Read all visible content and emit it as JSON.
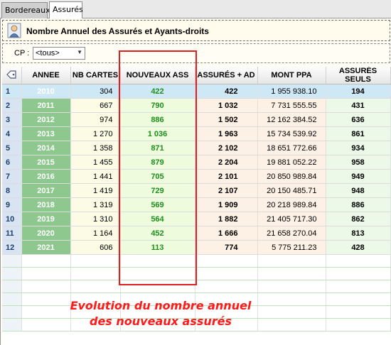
{
  "tabs": [
    {
      "label": "Bordereaux",
      "active": false
    },
    {
      "label": "Assurés",
      "active": true
    }
  ],
  "header": {
    "title": "Nombre Annuel des Assurés et Ayants-droits",
    "icon": "user-icon"
  },
  "filter": {
    "label": "CP :",
    "selected": "<tous>"
  },
  "table": {
    "columns": [
      "",
      "ANNEE",
      "NB CARTES",
      "NOUVEAUX ASS",
      "ASSURÉS + AD",
      "MONT PPA",
      "ASSURÉS SEULS"
    ],
    "rows": [
      [
        "1",
        "2010",
        "304",
        "422",
        "422",
        "1 955 938.10",
        "194"
      ],
      [
        "2",
        "2011",
        "667",
        "790",
        "1 032",
        "7 731 555.55",
        "431"
      ],
      [
        "3",
        "2012",
        "974",
        "886",
        "1 502",
        "12 162 384.52",
        "636"
      ],
      [
        "4",
        "2013",
        "1 270",
        "1 036",
        "1 963",
        "15 734 539.92",
        "861"
      ],
      [
        "5",
        "2014",
        "1 358",
        "871",
        "2 102",
        "18 651 772.66",
        "934"
      ],
      [
        "6",
        "2015",
        "1 455",
        "879",
        "2 204",
        "19 881 052.22",
        "958"
      ],
      [
        "7",
        "2016",
        "1 441",
        "705",
        "2 101",
        "20 850 989.84",
        "949"
      ],
      [
        "8",
        "2017",
        "1 419",
        "729",
        "2 107",
        "20 150 485.71",
        "948"
      ],
      [
        "9",
        "2018",
        "1 319",
        "569",
        "1 909",
        "20 218 989.84",
        "886"
      ],
      [
        "10",
        "2019",
        "1 310",
        "564",
        "1 882",
        "21 405 717.30",
        "862"
      ],
      [
        "11",
        "2020",
        "1 164",
        "452",
        "1 666",
        "21 658 270.04",
        "813"
      ],
      [
        "12",
        "2021",
        "606",
        "113",
        "774",
        "5 775 211.23",
        "428"
      ]
    ],
    "selected_row": 1
  },
  "annotation": {
    "line1": "Evolution du nombre annuel",
    "line2": "des nouveaux assurés",
    "color": "#ff1a1a"
  }
}
